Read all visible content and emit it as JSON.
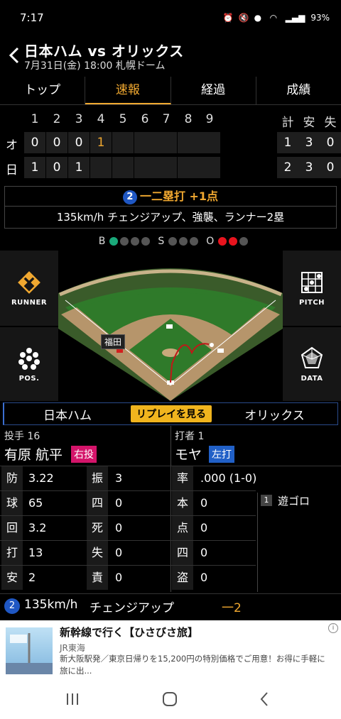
{
  "status": {
    "time": "7:17",
    "battery": "93%"
  },
  "header": {
    "title": "日本ハム vs オリックス",
    "subtitle": "7月31日(金) 18:00 札幌ドーム"
  },
  "tabs": [
    {
      "label": "トップ",
      "active": false
    },
    {
      "label": "速報",
      "active": true
    },
    {
      "label": "経過",
      "active": false
    },
    {
      "label": "成績",
      "active": false
    }
  ],
  "scoreboard": {
    "innings": [
      "1",
      "2",
      "3",
      "4",
      "5",
      "6",
      "7",
      "8",
      "9"
    ],
    "total_headers": [
      "計",
      "安",
      "失"
    ],
    "rows": [
      {
        "team": "オ",
        "scores": [
          "0",
          "0",
          "0",
          "1",
          "",
          "",
          "",
          "",
          ""
        ],
        "totals": [
          "1",
          "3",
          "0"
        ]
      },
      {
        "team": "日",
        "scores": [
          "1",
          "0",
          "1",
          "",
          "",
          "",
          "",
          "",
          ""
        ],
        "totals": [
          "2",
          "3",
          "0"
        ]
      }
    ]
  },
  "play": {
    "number": "2",
    "headline": "一二塁打 +1点",
    "detail": "135km/h チェンジアップ、強襲、ランナー2塁"
  },
  "bso": {
    "b_label": "B",
    "s_label": "S",
    "o_label": "O",
    "balls": 1,
    "strikes": 0,
    "outs": 2
  },
  "side_buttons": {
    "runner": "RUNNER",
    "pos": "POS.",
    "pitch": "PITCH",
    "data": "DATA"
  },
  "field": {
    "runner_label": "福田"
  },
  "teams_row": {
    "home": "日本ハム",
    "replay": "リプレイを見る",
    "away": "オリックス"
  },
  "pitcher": {
    "header": "投手 16",
    "name": "有原 航平",
    "badge": "右投",
    "stats_left": [
      {
        "k": "防",
        "v": "3.22"
      },
      {
        "k": "球",
        "v": "65"
      },
      {
        "k": "回",
        "v": "3.2"
      },
      {
        "k": "打",
        "v": "13"
      },
      {
        "k": "安",
        "v": "2"
      }
    ],
    "stats_right": [
      {
        "k": "振",
        "v": "3"
      },
      {
        "k": "四",
        "v": "0"
      },
      {
        "k": "死",
        "v": "0"
      },
      {
        "k": "失",
        "v": "0"
      },
      {
        "k": "責",
        "v": "0"
      }
    ]
  },
  "batter": {
    "header": "打者 1",
    "name": "モヤ",
    "badge": "左打",
    "rate_key": "率",
    "rate_value": ".000 (1-0)",
    "stats": [
      {
        "k": "本",
        "v": "0"
      },
      {
        "k": "点",
        "v": "0"
      },
      {
        "k": "四",
        "v": "0"
      },
      {
        "k": "盗",
        "v": "0"
      }
    ],
    "result_num": "1",
    "result": "遊ゴロ"
  },
  "pitch_row": {
    "number": "2",
    "speed": "135km/h",
    "type": "チェンジアップ",
    "result": "一2"
  },
  "ad": {
    "title": "新幹線で行く【ひさびさ旅】",
    "sponsor": "JR東海",
    "desc": "新大阪駅発／東京日帰りを15,200円の特別価格でご用意！お得に手軽に旅に出..."
  }
}
